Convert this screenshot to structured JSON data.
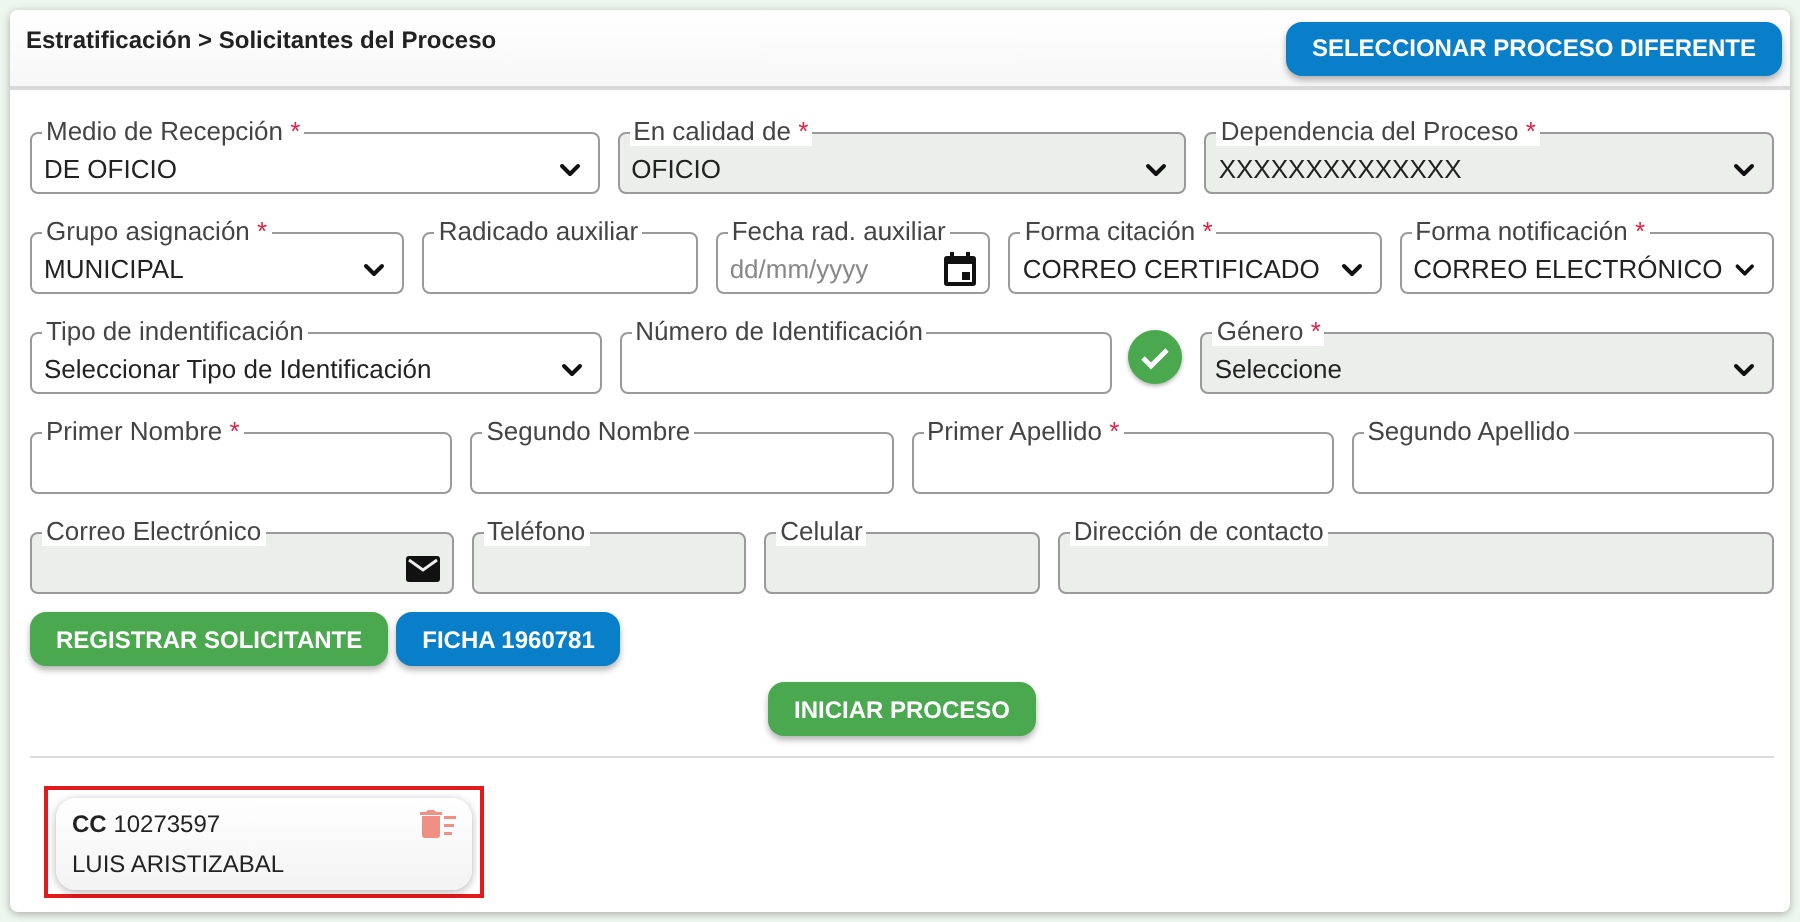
{
  "header": {
    "breadcrumb": "Estratificación > Solicitantes del Proceso",
    "action_button": "SELECCIONAR PROCESO DIFERENTE"
  },
  "form_rows": [
    [
      {
        "kind": "select",
        "label": "Medio de Recepción",
        "required_mark": "*",
        "value": "DE OFICIO",
        "disabled": false
      },
      {
        "kind": "select",
        "label": "En calidad de",
        "required_mark": "*",
        "value": "OFICIO",
        "disabled": true
      },
      {
        "kind": "select",
        "label": "Dependencia del Proceso",
        "required_mark": "*",
        "value": "XXXXXXXXXXXXXX",
        "disabled": true
      }
    ],
    [
      {
        "kind": "select",
        "label": "Grupo asignación",
        "required_mark": "*",
        "value": "MUNICIPAL",
        "disabled": false
      },
      {
        "kind": "text",
        "label": "Radicado auxiliar",
        "disabled": false
      },
      {
        "kind": "date",
        "label": "Fecha rad. auxiliar",
        "placeholder": "dd/mm/yyyy",
        "disabled": false
      },
      {
        "kind": "select",
        "label": "Forma citación",
        "required_mark": "*",
        "value": "CORREO CERTIFICADO",
        "disabled": false
      },
      {
        "kind": "select",
        "label": "Forma notificación",
        "required_mark": "*",
        "value": "CORREO ELECTRÓNICO",
        "disabled": false
      }
    ],
    [
      {
        "kind": "select",
        "label": "Tipo de indentificación",
        "value": "Seleccionar Tipo de Identificación",
        "disabled": false
      },
      {
        "kind": "text",
        "label": "Número de Identificación",
        "disabled": false,
        "verified": true
      },
      {
        "kind": "select",
        "label": "Género",
        "required_mark": "*",
        "value": "Seleccione",
        "disabled": true
      }
    ],
    [
      {
        "kind": "text",
        "label": "Primer Nombre",
        "required_mark": "*",
        "disabled": false
      },
      {
        "kind": "text",
        "label": "Segundo Nombre",
        "disabled": false
      },
      {
        "kind": "text",
        "label": "Primer Apellido",
        "required_mark": "*",
        "disabled": false
      },
      {
        "kind": "text",
        "label": "Segundo Apellido",
        "disabled": false
      }
    ],
    [
      {
        "kind": "email",
        "label": "Correo Electrónico",
        "disabled": true
      },
      {
        "kind": "text",
        "label": "Teléfono",
        "disabled": true
      },
      {
        "kind": "text",
        "label": "Celular",
        "disabled": true
      },
      {
        "kind": "text",
        "label": "Dirección de contacto",
        "disabled": true
      }
    ]
  ],
  "action_buttons": [
    {
      "label": "REGISTRAR SOLICITANTE",
      "kind": "success"
    },
    {
      "label": "FICHA 1960781",
      "kind": "primary"
    }
  ],
  "start_button": "INICIAR PROCESO",
  "applicants": [
    {
      "doc_type": "CC",
      "doc_number": "10273597",
      "name": "LUIS ARISTIZABAL",
      "highlighted": true
    }
  ]
}
